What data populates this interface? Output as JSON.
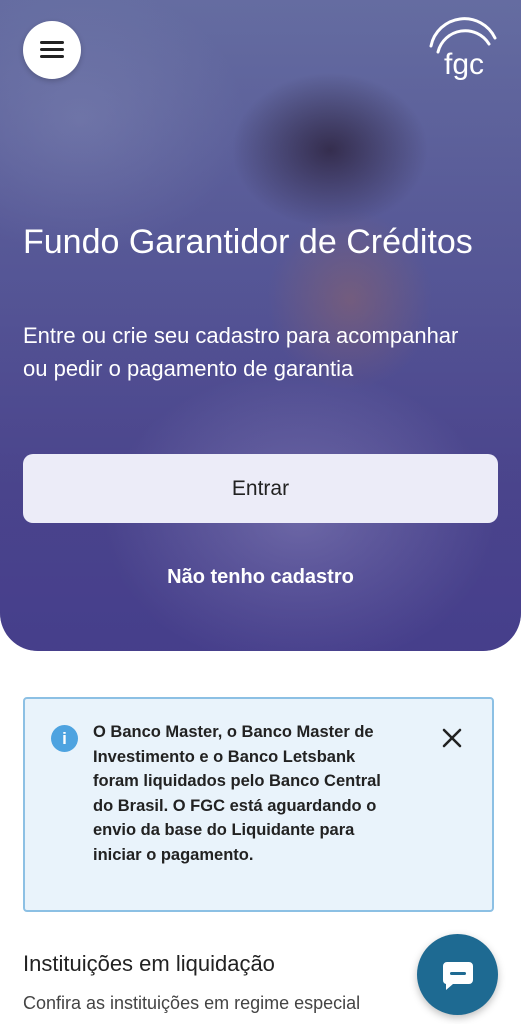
{
  "header": {
    "menu_icon": "hamburger-menu-icon",
    "logo_text": "fgc"
  },
  "hero": {
    "title": "Fundo Garantidor de Créditos",
    "subtitle": "Entre ou crie seu cadastro para acompanhar ou pedir o pagamento de garantia",
    "enter_label": "Entrar",
    "register_label": "Não tenho cadastro"
  },
  "alert": {
    "icon": "info-icon",
    "icon_glyph": "i",
    "text": "O Banco Master, o Banco Master de Investimento e o Banco Letsbank foram liquidados pelo Banco Central do Brasil. O FGC está aguardando o envio da base do Liquidante para iniciar o pagamento.",
    "close_icon": "close-icon"
  },
  "liquidation": {
    "title": "Instituições em liquidação",
    "subtitle": "Confira as instituições em regime especial"
  },
  "chat": {
    "icon": "chat-bubble-icon"
  },
  "colors": {
    "hero": "#4d4a8c",
    "button_bg": "#ececf8",
    "alert_bg": "#e9f3fb",
    "alert_border": "#8cc0e4",
    "info": "#4ea3e0",
    "chat": "#1e6a92"
  }
}
